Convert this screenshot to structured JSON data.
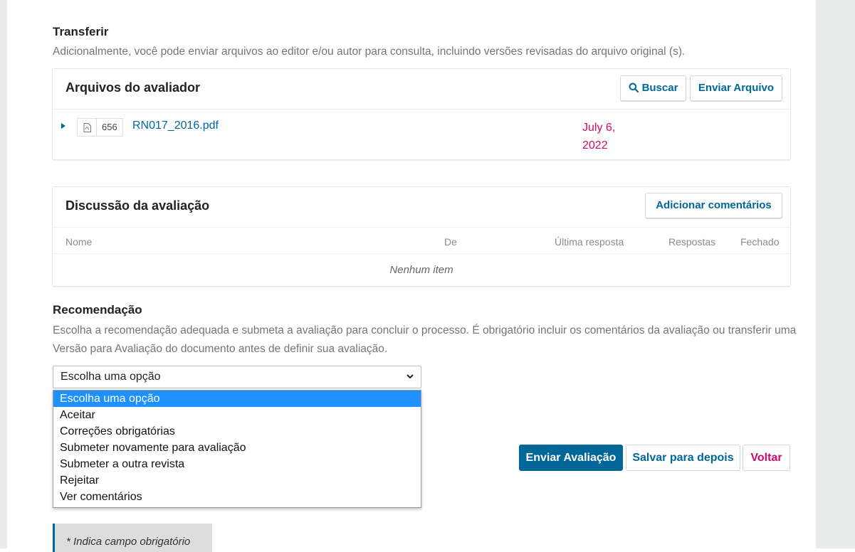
{
  "upload_section": {
    "title": "Transferir",
    "description": "Adicionalmente, você pode enviar arquivos ao editor e/ou autor para consulta, incluindo versões revisadas do arquivo original (s)."
  },
  "reviewer_files": {
    "title": "Arquivos do avaliador",
    "search_label": "Buscar",
    "upload_label": "Enviar Arquivo",
    "file": {
      "id": "656",
      "name": "RN017_2016.pdf",
      "date_line1": "July 6,",
      "date_line2": "2022",
      "icon": "pdf-file-icon"
    }
  },
  "discussion": {
    "title": "Discussão da avaliação",
    "add_label": "Adicionar comentários",
    "columns": [
      "Nome",
      "De",
      "Última resposta",
      "Respostas",
      "Fechado"
    ],
    "empty_text": "Nenhum item"
  },
  "recommendation": {
    "title": "Recomendação",
    "description": "Escolha a recomendação adequada e submeta a avaliação para concluir o processo. É obrigatório incluir os comentários da avaliação ou transferir uma Versão para Avaliação do documento antes de definir sua avaliação.",
    "selected": "Escolha uma opção",
    "options": [
      "Escolha uma opção",
      "Aceitar",
      "Correções obrigatórias",
      "Submeter novamente para avaliação",
      "Submeter a outra revista",
      "Rejeitar",
      "Ver comentários"
    ]
  },
  "actions": {
    "submit": "Enviar Avaliação",
    "save": "Salvar para depois",
    "back": "Voltar"
  },
  "required_note": "* Indica campo obrigatório",
  "colors": {
    "primary": "#006798",
    "danger": "#d00a6c",
    "highlight": "#1e90ff"
  }
}
